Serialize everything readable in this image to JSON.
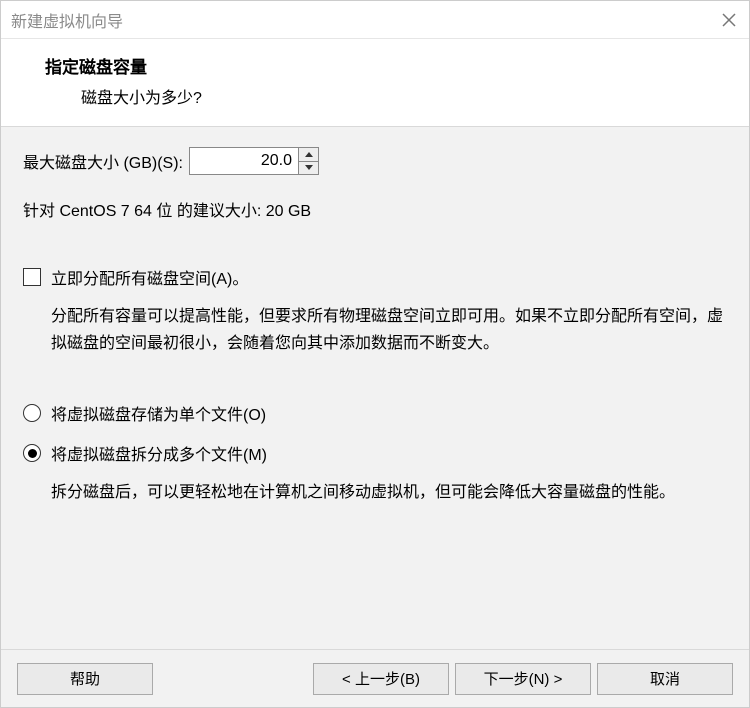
{
  "window": {
    "title": "新建虚拟机向导"
  },
  "header": {
    "title": "指定磁盘容量",
    "subtitle": "磁盘大小为多少?"
  },
  "size": {
    "label": "最大磁盘大小 (GB)(S):",
    "value": "20.0"
  },
  "recommend_text": "针对 CentOS 7 64 位 的建议大小: 20 GB",
  "allocate": {
    "label": "立即分配所有磁盘空间(A)。",
    "checked": false,
    "desc": "分配所有容量可以提高性能，但要求所有物理磁盘空间立即可用。如果不立即分配所有空间，虚拟磁盘的空间最初很小，会随着您向其中添加数据而不断变大。"
  },
  "store": {
    "single": {
      "label": "将虚拟磁盘存储为单个文件(O)",
      "selected": false
    },
    "split": {
      "label": "将虚拟磁盘拆分成多个文件(M)",
      "selected": true
    },
    "split_desc": "拆分磁盘后，可以更轻松地在计算机之间移动虚拟机，但可能会降低大容量磁盘的性能。"
  },
  "buttons": {
    "help": "帮助",
    "back": "< 上一步(B)",
    "next": "下一步(N) >",
    "cancel": "取消"
  }
}
